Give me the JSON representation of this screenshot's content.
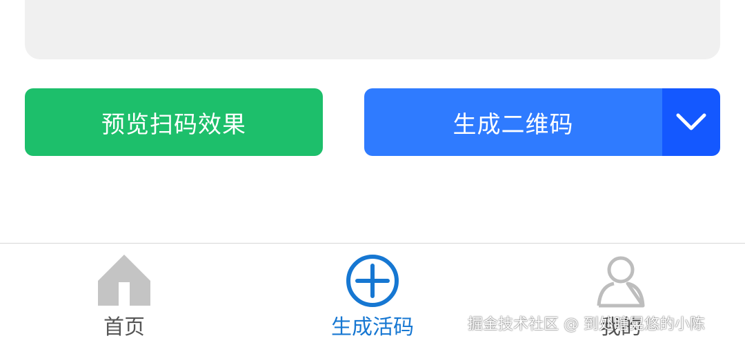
{
  "preview_panel": {},
  "actions": {
    "preview_label": "预览扫码效果",
    "generate_label": "生成二维码",
    "dropdown_icon": "chevron-down-icon"
  },
  "tabbar": {
    "tabs": [
      {
        "label": "首页",
        "icon": "home-icon",
        "active": false
      },
      {
        "label": "生成活码",
        "icon": "plus-circle-icon",
        "active": true
      },
      {
        "label": "我的",
        "icon": "user-icon",
        "active": false
      }
    ]
  },
  "watermark": "掘金技术社区 @ 到处瞎晃悠的小陈",
  "colors": {
    "preview_button": "#1dbf6b",
    "generate_button": "#2f7bff",
    "dropdown_button": "#1458ff",
    "tab_active": "#1677d2",
    "tab_inactive": "#555555",
    "panel_bg": "#f0f0f0"
  }
}
